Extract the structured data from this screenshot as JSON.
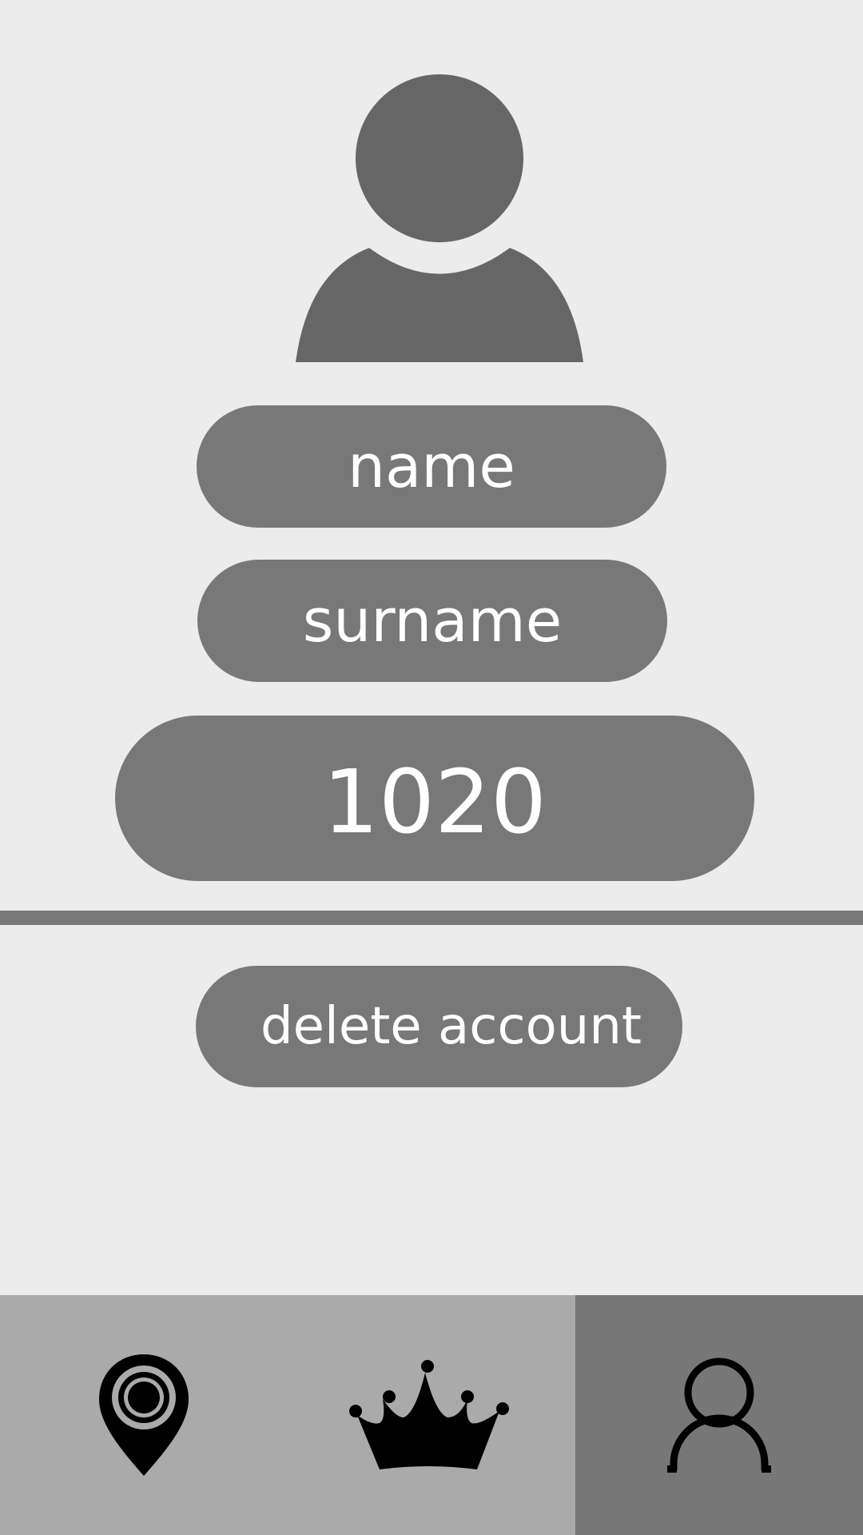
{
  "profile": {
    "avatar_icon": "user-silhouette-icon",
    "name": "name",
    "surname": "surname",
    "score": "1020"
  },
  "actions": {
    "delete_label": "delete account"
  },
  "nav": {
    "items": [
      {
        "id": "map",
        "icon": "map-pin-icon",
        "active": false
      },
      {
        "id": "leaderboard",
        "icon": "crown-icon",
        "active": false
      },
      {
        "id": "profile",
        "icon": "user-outline-icon",
        "active": true
      }
    ]
  },
  "colors": {
    "background": "#ececec",
    "pill": "#787878",
    "pill_text": "#ffffff",
    "divider": "#787878",
    "nav_inactive": "#aaaaaa",
    "nav_active": "#777777",
    "avatar": "#666666"
  }
}
